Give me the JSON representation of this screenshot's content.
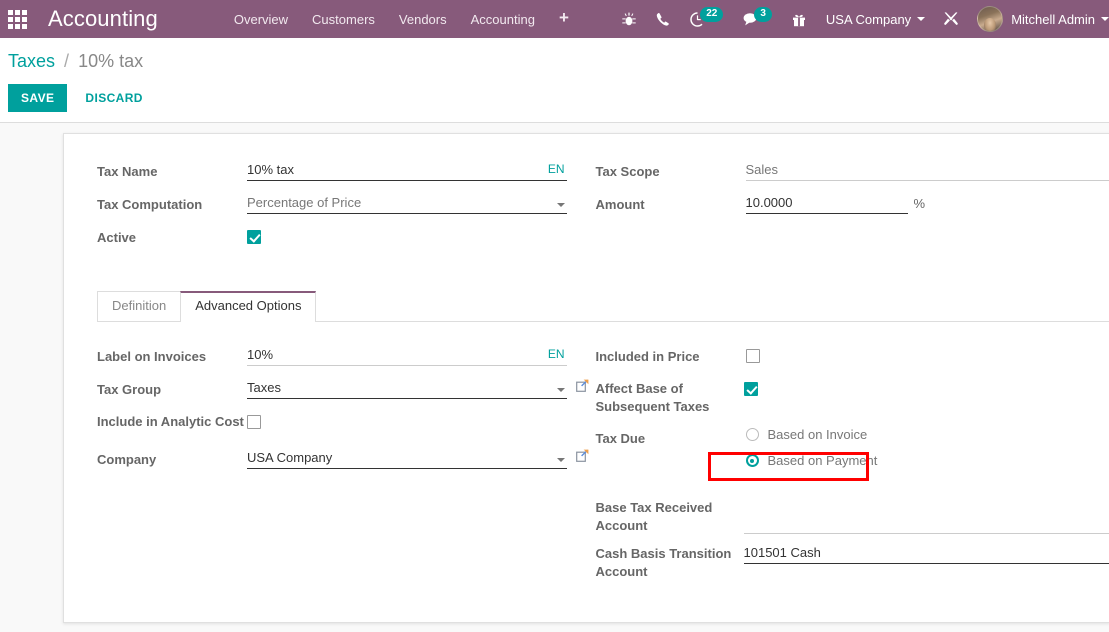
{
  "navbar": {
    "apps_icon": "apps-grid-icon",
    "brand": "Accounting",
    "menu": [
      {
        "label": "Overview",
        "name": "overview"
      },
      {
        "label": "Customers",
        "name": "customers"
      },
      {
        "label": "Vendors",
        "name": "vendors"
      },
      {
        "label": "Accounting",
        "name": "accounting"
      }
    ],
    "add_label": "+",
    "icons": [
      {
        "name": "bug-icon",
        "label": ""
      },
      {
        "name": "phone-icon",
        "label": ""
      }
    ],
    "activity": {
      "icon": "clock-icon",
      "count": "22"
    },
    "messages": {
      "icon": "chat-icon",
      "count": "3"
    },
    "gift": {
      "icon": "gift-icon"
    },
    "company": "USA Company",
    "tools_icon": "tools-icon",
    "user": "Mitchell Admin"
  },
  "control_panel": {
    "breadcrumb_root": "Taxes",
    "breadcrumb_sep": "/",
    "breadcrumb_current": "10% tax",
    "save_label": "SAVE",
    "discard_label": "DISCARD"
  },
  "form": {
    "header_left": [
      {
        "label": "Tax Name",
        "value": "10% tax",
        "lang": "EN",
        "type": "text"
      },
      {
        "label": "Tax Computation",
        "value": "Percentage of Price",
        "type": "select"
      },
      {
        "label": "Active",
        "value": "",
        "type": "checkbox",
        "checked": true
      }
    ],
    "header_right": [
      {
        "label": "Tax Scope",
        "value": "Sales",
        "type": "readonly"
      },
      {
        "label": "Amount",
        "value": "10.0000",
        "suffix": "%",
        "type": "number"
      }
    ],
    "tabs": [
      {
        "label": "Definition",
        "active": false
      },
      {
        "label": "Advanced Options",
        "active": true
      }
    ],
    "advanced_left": [
      {
        "label": "Label on Invoices",
        "value": "10%",
        "lang": "EN",
        "type": "text"
      },
      {
        "label": "Tax Group",
        "value": "Taxes",
        "type": "m2o"
      },
      {
        "label": "Include in Analytic Cost",
        "value": "",
        "type": "checkbox",
        "checked": false
      },
      {
        "label": "Company",
        "value": "USA Company",
        "type": "m2o"
      }
    ],
    "advanced_right": [
      {
        "label": "Included in Price",
        "type": "checkbox",
        "checked": false
      },
      {
        "label": "Affect Base of Subsequent Taxes",
        "type": "checkbox",
        "checked": true
      },
      {
        "label": "Tax Due",
        "type": "radio",
        "options": [
          {
            "label": "Based on Invoice",
            "selected": false
          },
          {
            "label": "Based on Payment",
            "selected": true
          }
        ]
      },
      {
        "label": "Base Tax Received Account",
        "value": "",
        "type": "m2o-empty"
      },
      {
        "label": "Cash Basis Transition Account",
        "value": "101501 Cash",
        "type": "m2o-plain"
      }
    ]
  },
  "annotation": {
    "target": "Based on Payment",
    "color": "#FF0000"
  },
  "colors": {
    "brand_purple": "#875A7B",
    "accent_teal": "#00A09D",
    "annotation_red": "#FF0000",
    "label_gray": "#666666",
    "value_gray": "#777777"
  }
}
